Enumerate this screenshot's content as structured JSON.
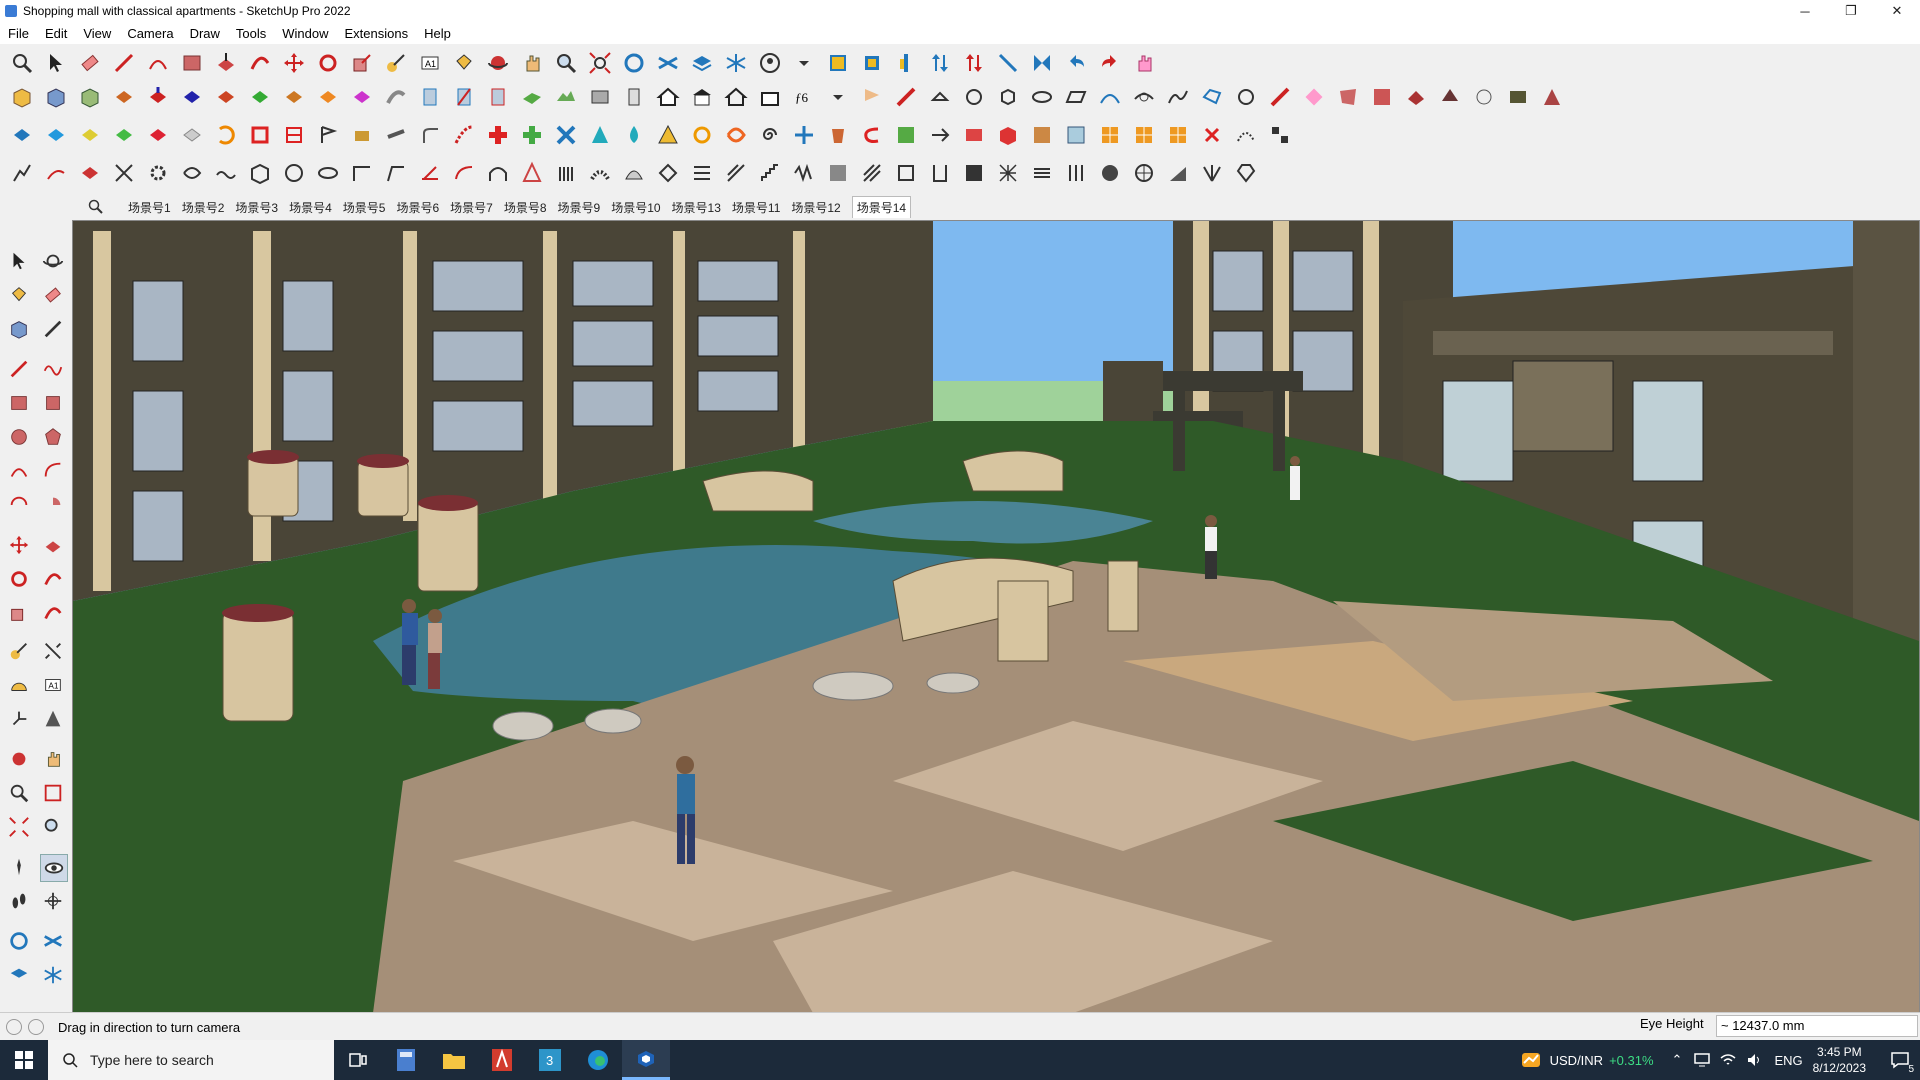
{
  "window": {
    "title": "Shopping mall with classical apartments - SketchUp Pro 2022",
    "controls": {
      "minimize": "─",
      "maximize": "❐",
      "close": "✕"
    }
  },
  "menu": [
    "File",
    "Edit",
    "View",
    "Camera",
    "Draw",
    "Tools",
    "Window",
    "Extensions",
    "Help"
  ],
  "scenes": {
    "tabs": [
      "场景号1",
      "场景号2",
      "场景号3",
      "场景号4",
      "场景号5",
      "场景号6",
      "场景号7",
      "场景号8",
      "场景号9",
      "场景号10",
      "场景号13",
      "场景号11",
      "场景号12",
      "场景号14"
    ],
    "active_index": 13
  },
  "status": {
    "message": "Drag in direction to turn camera",
    "measure_label": "Eye Height",
    "measure_value": "~ 12437.0 mm"
  },
  "taskbar": {
    "search_placeholder": "Type here to search",
    "currency_pair": "USD/INR",
    "currency_change": "+0.31%",
    "lang": "ENG",
    "time": "3:45 PM",
    "date": "8/12/2023",
    "notifications": "5"
  }
}
